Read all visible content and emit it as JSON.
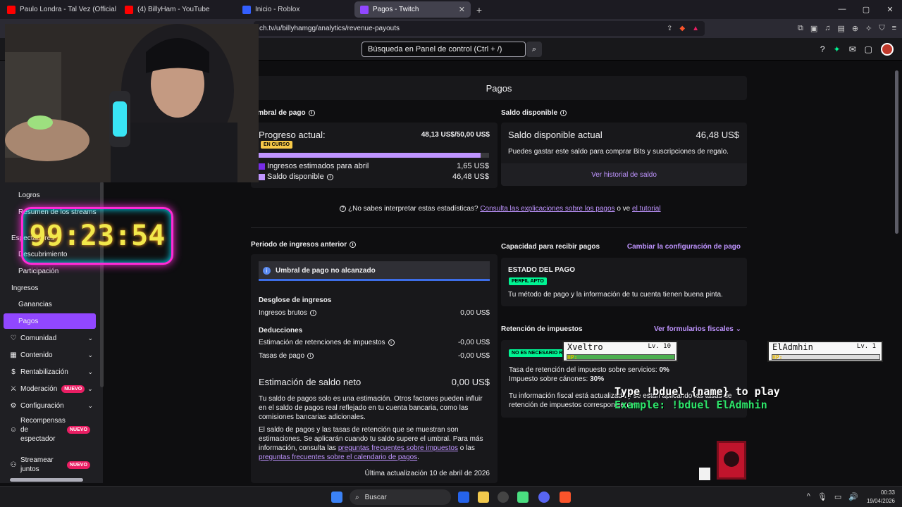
{
  "browser": {
    "tabs": [
      {
        "title": "Paulo Londra - Tal Vez (Official Video)",
        "color": "#ff0000",
        "active": false
      },
      {
        "title": "(4) BillyHam - YouTube",
        "color": "#ff0000",
        "active": false
      },
      {
        "title": "Inicio - Roblox",
        "color": "#335fff",
        "active": false
      },
      {
        "title": "Pagos - Twitch",
        "color": "#9147ff",
        "active": true
      }
    ],
    "new_tab": "+",
    "url": "ch.tv/u/billyhamgg/analytics/revenue-payouts",
    "window_controls": [
      "—",
      "▢",
      "✕"
    ]
  },
  "topnav": {
    "search_placeholder": "Búsqueda en Panel de control (Ctrl + /)"
  },
  "sidebar": {
    "items": [
      {
        "label": "Logros",
        "kind": "sub"
      },
      {
        "label": "Resumen de los streams",
        "kind": "sub"
      },
      {
        "label": "Espectadores",
        "kind": "top"
      },
      {
        "label": "Descubrimiento",
        "kind": "sub"
      },
      {
        "label": "Participación",
        "kind": "sub"
      },
      {
        "label": "Ingresos",
        "kind": "top"
      },
      {
        "label": "Ganancias",
        "kind": "sub"
      },
      {
        "label": "Pagos",
        "kind": "sub",
        "active": true
      },
      {
        "label": "Comunidad",
        "kind": "icon",
        "icon": "heart-icon"
      },
      {
        "label": "Contenido",
        "kind": "icon",
        "icon": "content-icon"
      },
      {
        "label": "Rentabilización",
        "kind": "icon",
        "icon": "money-icon"
      },
      {
        "label": "Moderación",
        "kind": "icon",
        "icon": "sword-icon",
        "badge": "NUEVO"
      },
      {
        "label": "Configuración",
        "kind": "icon",
        "icon": "gear-icon"
      },
      {
        "label": "Recompensas de espectador",
        "kind": "icon",
        "icon": "reward-icon",
        "badge": "NUEVO"
      },
      {
        "label": "Streamear juntos",
        "kind": "icon",
        "icon": "people-icon",
        "badge": "NUEVO"
      }
    ]
  },
  "overlay": {
    "timer": "99:23:54",
    "players": [
      {
        "name": "Xveltro",
        "level": "Lv. 10",
        "hp_label": "HP:",
        "hp": 1.0
      },
      {
        "name": "ElAdmhin",
        "level": "Lv. 1",
        "hp_label": "HP:",
        "hp": 0.0
      }
    ],
    "line1": "Type !bduel {name} to play",
    "line2": "Example: !bduel ElAdmhin"
  },
  "page": {
    "title": "Pagos",
    "threshold": {
      "heading": "Umbral de pago",
      "progress_label": "Progreso actual:",
      "progress_value": "48,13 US$/50,00 US$",
      "progress_fraction": 0.9626,
      "status": "EN CURSO",
      "rows": [
        {
          "label": "Ingresos estimados para abril",
          "value": "1,65 US$",
          "color": "#772ce8"
        },
        {
          "label": "Saldo disponible",
          "value": "46,48 US$",
          "color": "#bf94ff"
        }
      ]
    },
    "balance": {
      "heading": "Saldo disponible",
      "label": "Saldo disponible actual",
      "value": "46,48 US$",
      "desc": "Puedes gastar este saldo para comprar Bits y suscripciones de regalo.",
      "history_link": "Ver historial de saldo"
    },
    "help": {
      "prefix": "¿No sabes interpretar estas estadísticas?",
      "link1": "Consulta las explicaciones sobre los pagos",
      "middle": "o ve",
      "link2": "el tutorial"
    },
    "prev_period": {
      "heading": "Periodo de ingresos anterior",
      "alert": "Umbral de pago no alcanzado",
      "breakdown_title": "Desglose de ingresos",
      "gross_label": "Ingresos brutos",
      "gross_value": "0,00 US$",
      "deductions_title": "Deducciones",
      "tax_label": "Estimación de retenciones de impuestos",
      "tax_value": "-0,00 US$",
      "fee_label": "Tasas de pago",
      "fee_value": "-0,00 US$",
      "net_label": "Estimación de saldo neto",
      "net_value": "0,00 US$",
      "p1": "Tu saldo de pagos solo es una estimación. Otros factores pueden influir en el saldo de pagos real reflejado en tu cuenta bancaria, como las comisiones bancarias adicionales.",
      "p2a": "El saldo de pagos y las tasas de retención que se muestran son estimaciones. Se aplicarán cuando tu saldo supere el umbral. Para más información, consulta las",
      "p2link1": "preguntas frecuentes sobre impuestos",
      "p2mid": "o las",
      "p2link2": "preguntas frecuentes sobre el calendario de pagos",
      "p2end": ".",
      "updated": "Última actualización 10 de abril de 2026"
    },
    "capacity": {
      "heading": "Capacidad para recibir pagos",
      "action": "Cambiar la configuración de pago",
      "status_title": "ESTADO DEL PAGO",
      "status_badge": "PERFIL APTO",
      "status_desc": "Tu método de pago y la información de tu cuenta tienen buena pinta."
    },
    "tax": {
      "heading": "Retención de impuestos",
      "action": "Ver formularios fiscales",
      "badge": "NO ES NECESARIO R",
      "services_label": "Tasa de retención del impuesto sobre servicios:",
      "services_value": "0%",
      "royalty_label": "Impuesto sobre cánones:",
      "royalty_value": "30%",
      "note": "Tu información fiscal está actualizada y se están aplicando las tasas de retención de impuestos correspondientes."
    }
  },
  "taskbar": {
    "search": "Buscar",
    "time": "00:33",
    "date": "19/04/2026"
  }
}
